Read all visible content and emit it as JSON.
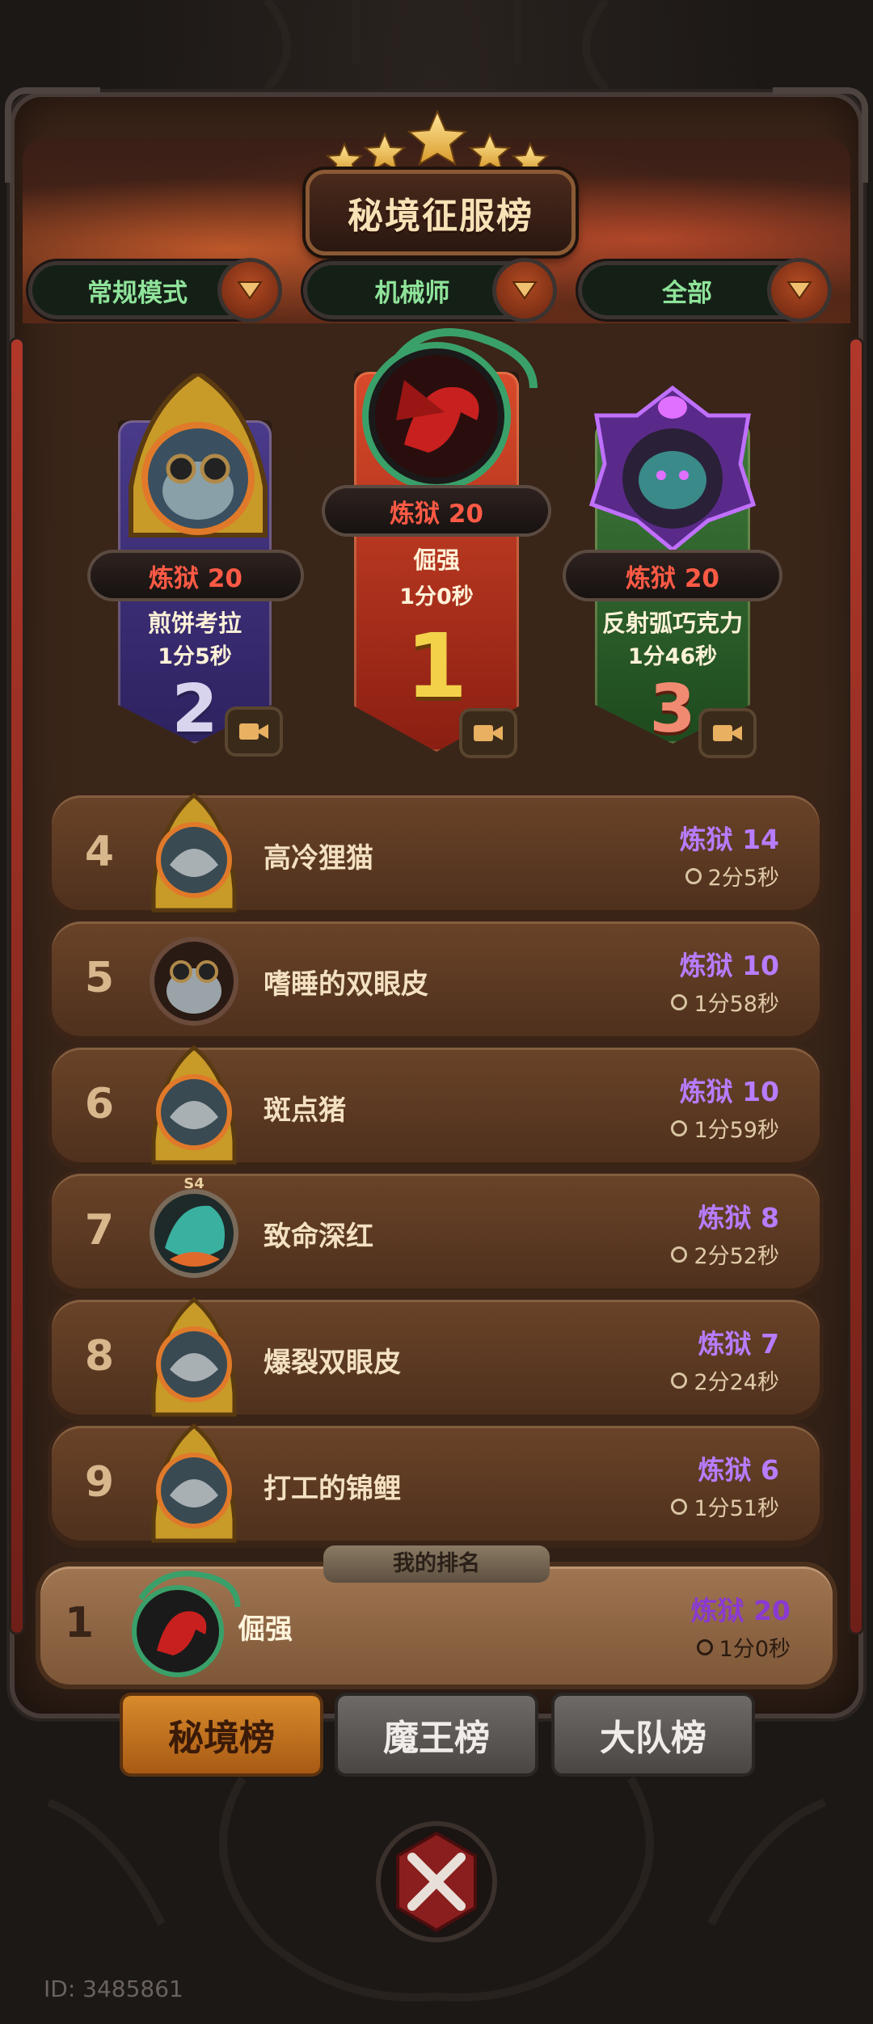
{
  "title": "秘境征服榜",
  "filters": [
    {
      "label": "常规模式"
    },
    {
      "label": "机械师"
    },
    {
      "label": "全部"
    }
  ],
  "podium": {
    "first": {
      "level": "炼狱 20",
      "name": "倔强",
      "time": "1分0秒",
      "rank": "1"
    },
    "second": {
      "level": "炼狱 20",
      "name": "煎饼考拉",
      "time": "1分5秒",
      "rank": "2"
    },
    "third": {
      "level": "炼狱 20",
      "name": "反射弧巧克力",
      "time": "1分46秒",
      "rank": "3"
    }
  },
  "rows": [
    {
      "rank": "4",
      "name": "高冷狸猫",
      "level": "炼狱 14",
      "time": "2分5秒",
      "avatar": "rocket-cat-icon"
    },
    {
      "rank": "5",
      "name": "嗜睡的双眼皮",
      "level": "炼狱 10",
      "time": "1分58秒",
      "avatar": "goggles-koala-icon"
    },
    {
      "rank": "6",
      "name": "斑点猪",
      "level": "炼狱 10",
      "time": "1分59秒",
      "avatar": "rocket-cat-icon"
    },
    {
      "rank": "7",
      "name": "致命深红",
      "level": "炼狱 8",
      "time": "2分52秒",
      "avatar": "dragon-s4-icon",
      "badge": "S4"
    },
    {
      "rank": "8",
      "name": "爆裂双眼皮",
      "level": "炼狱 7",
      "time": "2分24秒",
      "avatar": "rocket-cat-icon"
    },
    {
      "rank": "9",
      "name": "打工的锦鲤",
      "level": "炼狱 6",
      "time": "1分51秒",
      "avatar": "rocket-cat-icon"
    }
  ],
  "my_rank": {
    "label": "我的排名",
    "rank": "1",
    "name": "倔强",
    "level": "炼狱 20",
    "time": "1分0秒"
  },
  "tabs": [
    {
      "label": "秘境榜",
      "active": true
    },
    {
      "label": "魔王榜",
      "active": false
    },
    {
      "label": "大队榜",
      "active": false
    }
  ],
  "footer_id": "ID: 3485861",
  "colors": {
    "level_purple": "#b77cff",
    "level_red": "#ff5a45",
    "filter_green": "#8fe39a",
    "tab_active": "#d88a2c"
  }
}
